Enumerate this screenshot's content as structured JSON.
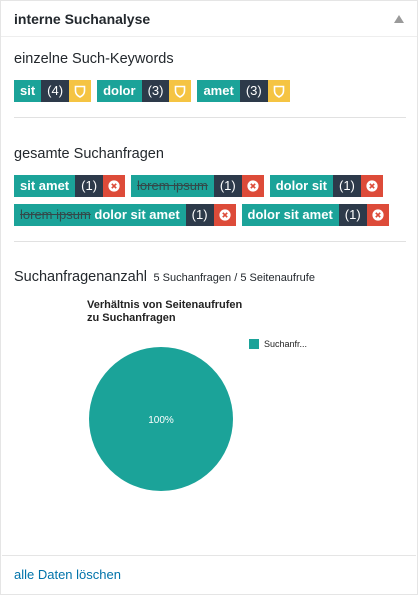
{
  "widget": {
    "title": "interne Suchanalyse"
  },
  "keywords": {
    "title": "einzelne Such-Keywords",
    "items": [
      {
        "label": "sit",
        "count": "(4)"
      },
      {
        "label": "dolor",
        "count": "(3)"
      },
      {
        "label": "amet",
        "count": "(3)"
      }
    ]
  },
  "queries": {
    "title": "gesamte Suchanfragen",
    "rows": [
      [
        {
          "plain": "sit amet",
          "strike": "",
          "count": "(1)"
        },
        {
          "plain": "",
          "strike": "lorem ipsum",
          "count": "(1)"
        },
        {
          "plain": "dolor sit",
          "strike": "",
          "count": "(1)"
        }
      ],
      [
        {
          "plain": " dolor sit amet",
          "strike": "lorem ipsum",
          "count": "(1)"
        },
        {
          "plain": "dolor sit amet",
          "strike": "",
          "count": "(1)"
        }
      ]
    ]
  },
  "summary": {
    "label": "Suchanfragenanzahl",
    "stats": "5 Suchanfragen / 5 Seitenaufrufe"
  },
  "chart_data": {
    "type": "pie",
    "title": "Verhältnis von Seitenaufrufen zu Suchanfragen",
    "slices": [
      {
        "name": "Suchanfr...",
        "value": 100,
        "label": "100%",
        "color": "#1ba399"
      }
    ],
    "legend_position": "top-right"
  },
  "footer": {
    "link": "alle Daten löschen"
  },
  "colors": {
    "tag": "#1ba399",
    "count": "#2d3a4a",
    "shield": "#f5c443",
    "remove": "#dd4b39",
    "link": "#0073aa"
  }
}
